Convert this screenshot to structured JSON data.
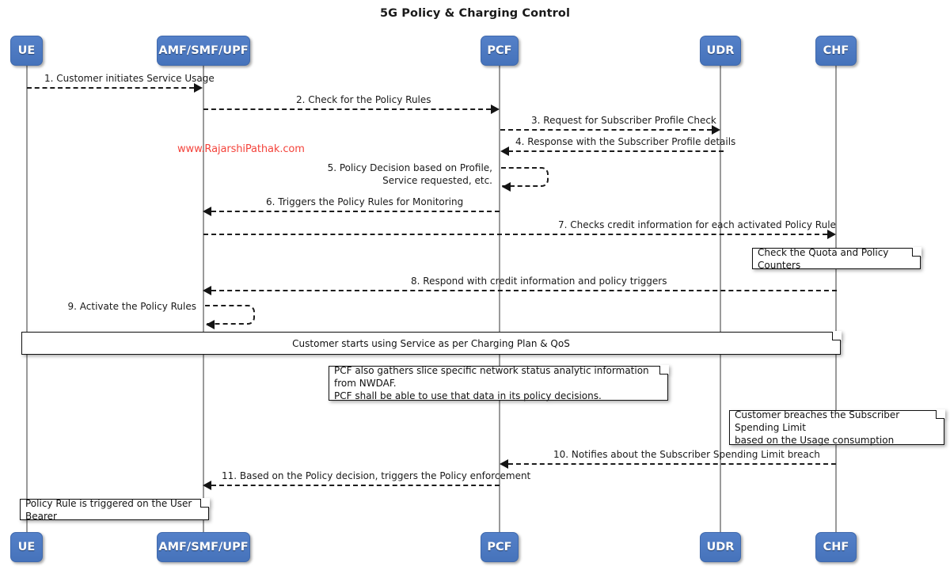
{
  "title": "5G Policy & Charging Control",
  "watermark": "www.RajarshiPathak.com",
  "colors": {
    "participant_fill": "#4b78c0",
    "participant_text": "#ffffff",
    "lifeline": "#9a9a9a",
    "message": "#1c1c1c",
    "watermark": "#f4443c",
    "note_border": "#121212",
    "note_fill": "#ffffff"
  },
  "participants": [
    {
      "id": "ue",
      "label": "UE"
    },
    {
      "id": "amf",
      "label": "AMF/SMF/UPF"
    },
    {
      "id": "pcf",
      "label": "PCF"
    },
    {
      "id": "udr",
      "label": "UDR"
    },
    {
      "id": "chf",
      "label": "CHF"
    }
  ],
  "participants_bottom": [
    {
      "id": "ue",
      "label": "UE"
    },
    {
      "id": "amf",
      "label": "AMF/SMF/UPF"
    },
    {
      "id": "pcf",
      "label": "PCF"
    },
    {
      "id": "udr",
      "label": "UDR"
    },
    {
      "id": "chf",
      "label": "CHF"
    }
  ],
  "messages": [
    {
      "num": "1",
      "label": "1. Customer initiates Service Usage",
      "from": "ue",
      "to": "amf",
      "dir": "right"
    },
    {
      "num": "2",
      "label": "2. Check for the Policy Rules",
      "from": "amf",
      "to": "pcf",
      "dir": "right"
    },
    {
      "num": "3",
      "label": "3. Request for Subscriber Profile Check",
      "from": "pcf",
      "to": "udr",
      "dir": "right"
    },
    {
      "num": "4",
      "label": "4. Response with the Subscriber Profile details",
      "from": "udr",
      "to": "pcf",
      "dir": "left"
    },
    {
      "num": "5",
      "label": "5. Policy Decision based on Profile,\nService requested, etc.",
      "from": "pcf",
      "to": "pcf",
      "dir": "self"
    },
    {
      "num": "6",
      "label": "6. Triggers the Policy Rules for Monitoring",
      "from": "pcf",
      "to": "amf",
      "dir": "left"
    },
    {
      "num": "7",
      "label": "7. Checks credit information for each activated Policy Rule",
      "from": "amf",
      "to": "chf",
      "dir": "right"
    },
    {
      "num": "8",
      "label": "8. Respond with credit information and policy triggers",
      "from": "chf",
      "to": "amf",
      "dir": "left"
    },
    {
      "num": "9",
      "label": "9. Activate the Policy Rules",
      "from": "amf",
      "to": "amf",
      "dir": "self"
    },
    {
      "num": "10",
      "label": "10. Notifies about the Subscriber Spending Limit breach",
      "from": "chf",
      "to": "pcf",
      "dir": "left"
    },
    {
      "num": "11",
      "label": "11. Based on the Policy decision, triggers the Policy enforcement",
      "from": "pcf",
      "to": "amf",
      "dir": "left"
    }
  ],
  "notes": [
    {
      "id": "note-quota",
      "text": "Check the Quota and Policy Counters"
    },
    {
      "id": "note-span",
      "text": "Customer starts using Service as per Charging Plan & QoS"
    },
    {
      "id": "note-nwdaf",
      "text": "PCF also gathers slice specific network status analytic information from NWDAF.\nPCF shall be able to use that data in its policy decisions."
    },
    {
      "id": "note-breach",
      "text": "Customer breaches the Subscriber Spending Limit\nbased on the Usage consumption"
    },
    {
      "id": "note-policyrule",
      "text": "Policy Rule is triggered on the User Bearer"
    }
  ]
}
